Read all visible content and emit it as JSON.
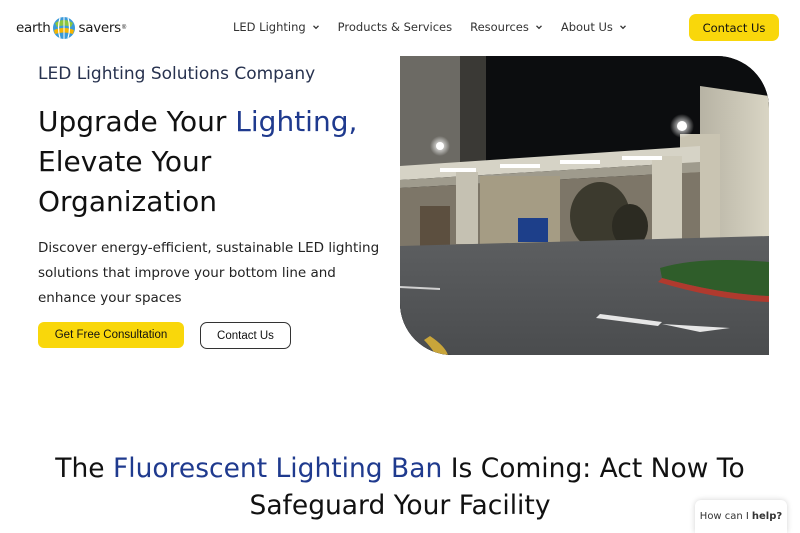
{
  "header": {
    "logo": {
      "left": "earth",
      "right": "savers",
      "mark": "®"
    },
    "nav": [
      {
        "label": "LED Lighting",
        "has_dropdown": true
      },
      {
        "label": "Products & Services",
        "has_dropdown": false
      },
      {
        "label": "Resources",
        "has_dropdown": true
      },
      {
        "label": "About Us",
        "has_dropdown": true
      }
    ],
    "contact_button": "Contact Us"
  },
  "hero": {
    "eyebrow": "LED Lighting Solutions Company",
    "headline_part1": "Upgrade Your ",
    "headline_accent": "Lighting,",
    "headline_part2": "Elevate Your Organization",
    "subtext": "Discover energy-efficient, sustainable LED lighting solutions that improve your bottom line and enhance your spaces",
    "primary_button": "Get Free Consultation",
    "secondary_button": "Contact Us"
  },
  "ban_section": {
    "title_part1": "The ",
    "title_accent": "Fluorescent Lighting Ban",
    "title_part2": " Is Coming: Act Now To Safeguard Your Facility"
  },
  "chat": {
    "prefix": "How can I",
    "bold": "help?"
  },
  "colors": {
    "accent_blue": "#1f3a8e",
    "button_yellow": "#f9d70b"
  }
}
